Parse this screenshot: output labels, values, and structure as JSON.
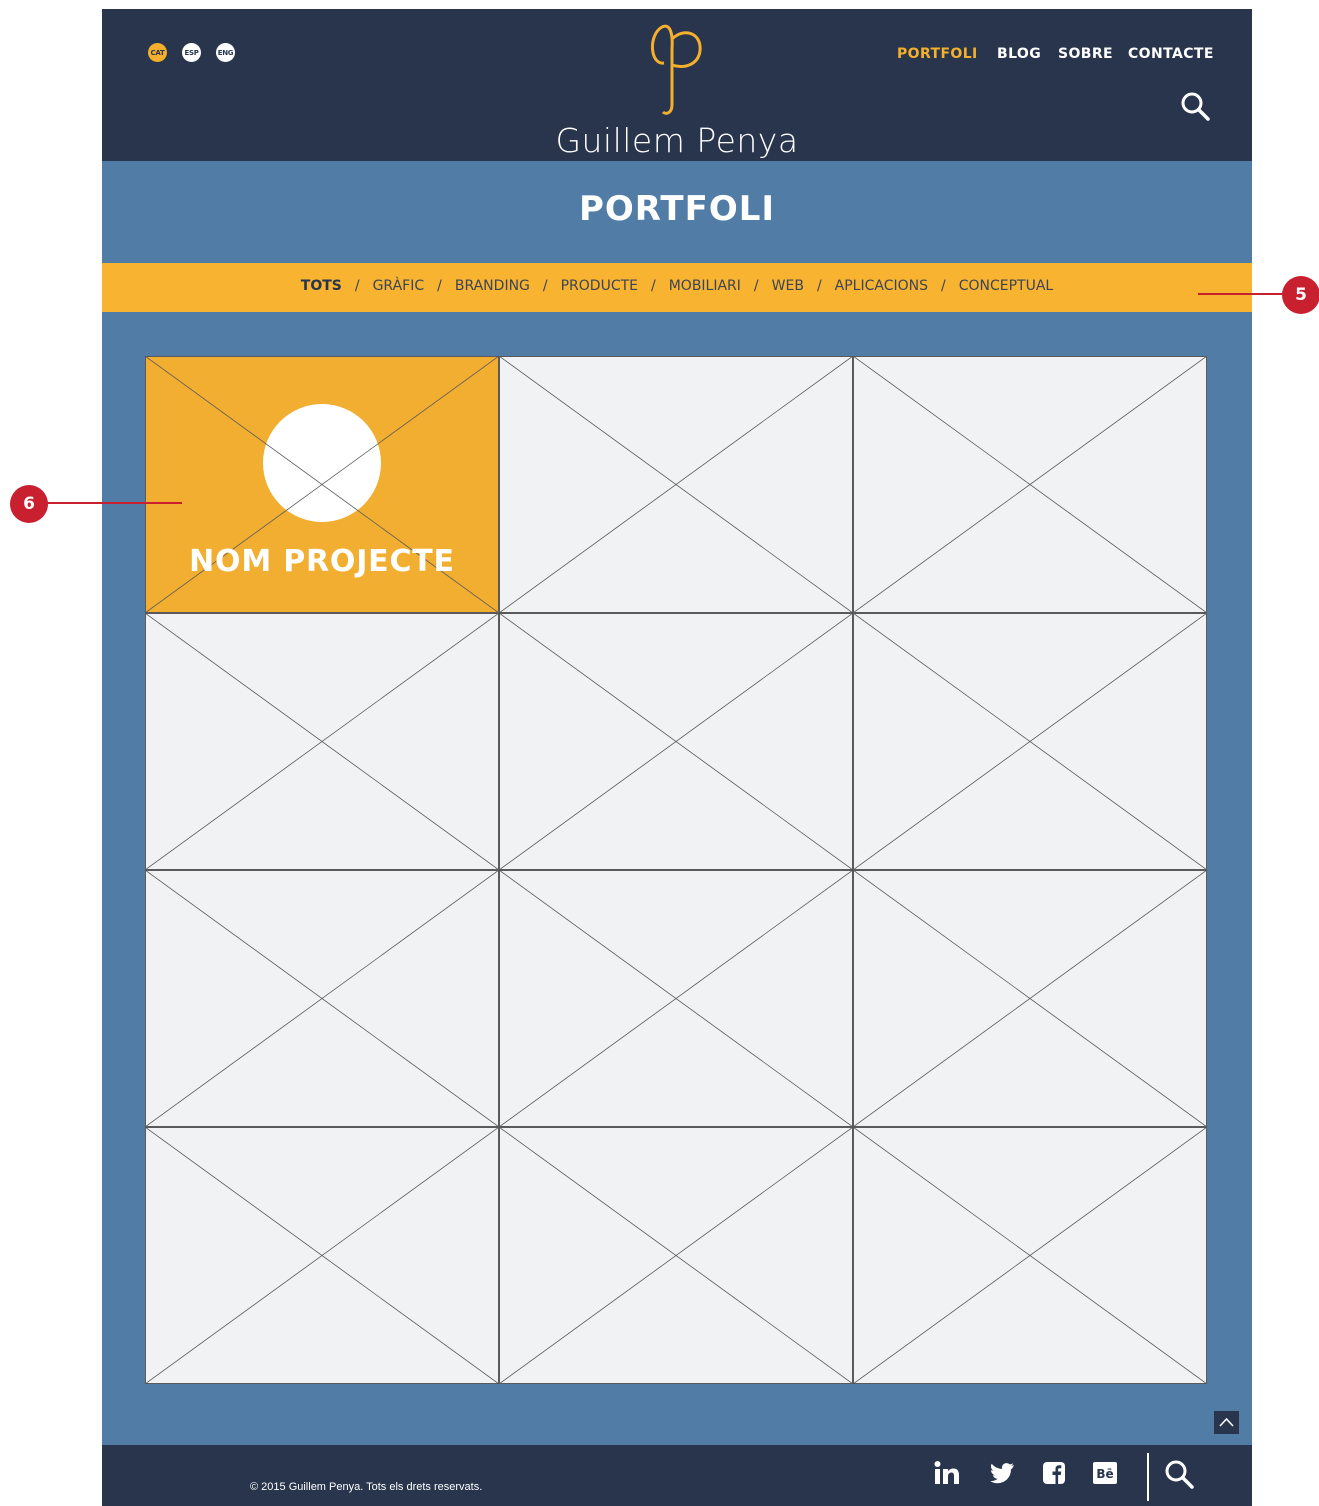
{
  "header": {
    "languages": [
      "CAT",
      "ESP",
      "ENG"
    ],
    "logo_name": "Guillem Penya",
    "nav": [
      "PORTFOLI",
      "BLOG",
      "SOBRE",
      "CONTACTE"
    ]
  },
  "title": "PORTFOLI",
  "filters": [
    "TOTS",
    "GRÀFIC",
    "BRANDING",
    "PRODUCTE",
    "MOBILIARI",
    "WEB",
    "APLICACIONS",
    "CONCEPTUAL"
  ],
  "filter_separator": "/",
  "featured_tile": {
    "label": "NOM PROJECTE"
  },
  "footer": {
    "copyright": "© 2015 Guillem Penya. Tots els drets reservats.",
    "social_icons": [
      "linkedin-icon",
      "twitter-icon",
      "facebook-icon",
      "behance-icon"
    ]
  },
  "annotations": [
    "5",
    "6"
  ],
  "colors": {
    "header_bg": "#29354c",
    "page_bg": "#517ca6",
    "accent": "#f4b02d",
    "filter_bar": "#f8b431",
    "tile_bg": "#f1f2f4",
    "annotation": "#c8202f"
  }
}
